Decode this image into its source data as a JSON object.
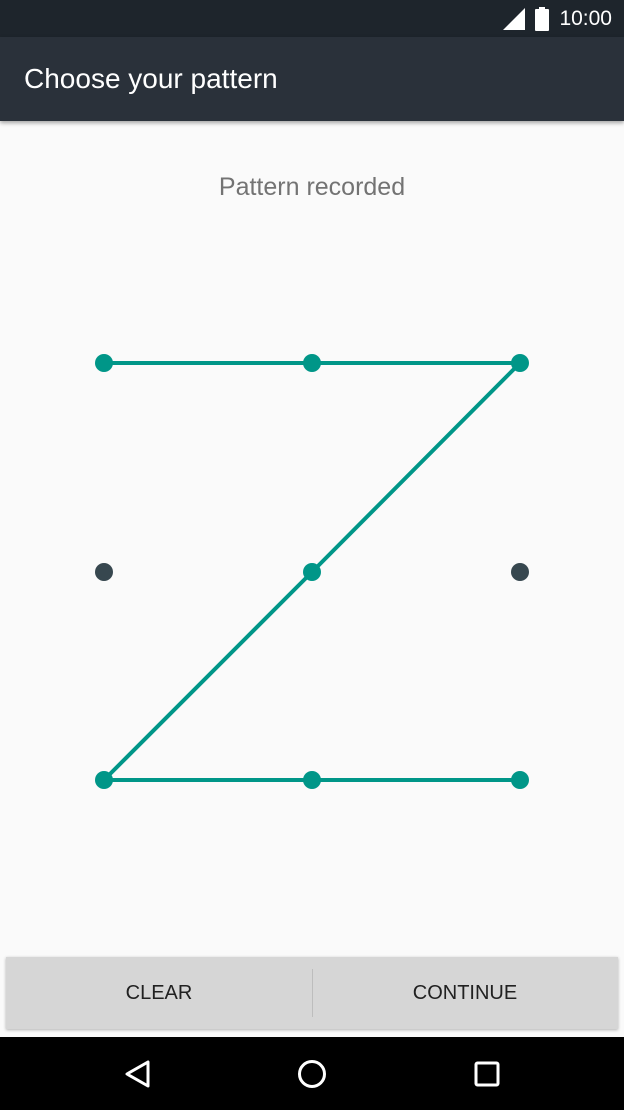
{
  "status_bar": {
    "time": "10:00",
    "icons": [
      "signal-icon",
      "battery-icon"
    ]
  },
  "app_bar": {
    "title": "Choose your pattern"
  },
  "pattern": {
    "message": "Pattern recorded",
    "grid": "3x3",
    "drawn_sequence": [
      1,
      2,
      3,
      5,
      7,
      8,
      9
    ],
    "colors": {
      "active": "#009688",
      "inactive": "#37474f"
    }
  },
  "buttons": {
    "clear_label": "CLEAR",
    "continue_label": "CONTINUE"
  },
  "nav_bar": {
    "icons": [
      "back-icon",
      "home-icon",
      "recents-icon"
    ]
  }
}
